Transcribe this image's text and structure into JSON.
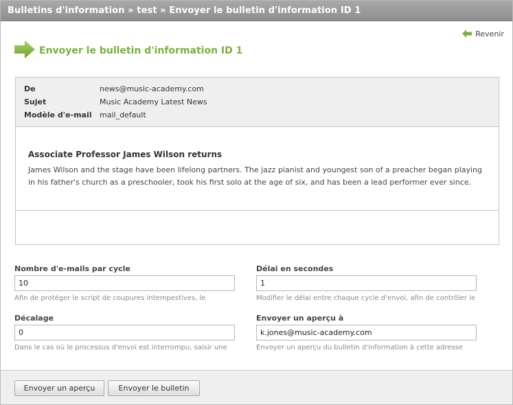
{
  "breadcrumb": "Bulletins d'information » test » Envoyer le bulletin d'information ID 1",
  "back_link": "Revenir",
  "page_title": "Envoyer le bulletin d'information ID 1",
  "message": {
    "from_label": "De",
    "from_value": "news@music-academy.com",
    "subject_label": "Sujet",
    "subject_value": "Music Academy Latest News",
    "template_label": "Modèle d'e-mail",
    "template_value": "mail_default",
    "heading": "Associate Professor James Wilson returns",
    "body": "James Wilson and the stage have been lifelong partners. The jazz pianist and youngest son of a preacher began playing in his father's church as a preschooler, took his first solo at the age of six, and has been a lead performer ever since."
  },
  "form": {
    "emails_per_cycle": {
      "label": "Nombre d'e-mails par cycle",
      "value": "10",
      "hint": "Afin de protéger le script de coupures intempestives, le"
    },
    "delay_seconds": {
      "label": "Délai en secondes",
      "value": "1",
      "hint": "Modifier le délai entre chaque cycle d'envoi, afin de contrôler le"
    },
    "offset": {
      "label": "Décalage",
      "value": "0",
      "hint": "Dans le cas où le processus d'envoi est interrompu, saisir une"
    },
    "preview_to": {
      "label": "Envoyer un aperçu à",
      "value": "k.jones@music-academy.com",
      "hint": "Envoyer un aperçu du bulletin d'information à cette adresse"
    }
  },
  "buttons": {
    "send_preview": "Envoyer un aperçu",
    "send_newsletter": "Envoyer le bulletin"
  },
  "colors": {
    "accent_green": "#79b13a",
    "titlebar_gray": "#9b9b9b"
  },
  "icons": {
    "back": "arrow-left-icon",
    "title": "arrow-right-icon"
  }
}
